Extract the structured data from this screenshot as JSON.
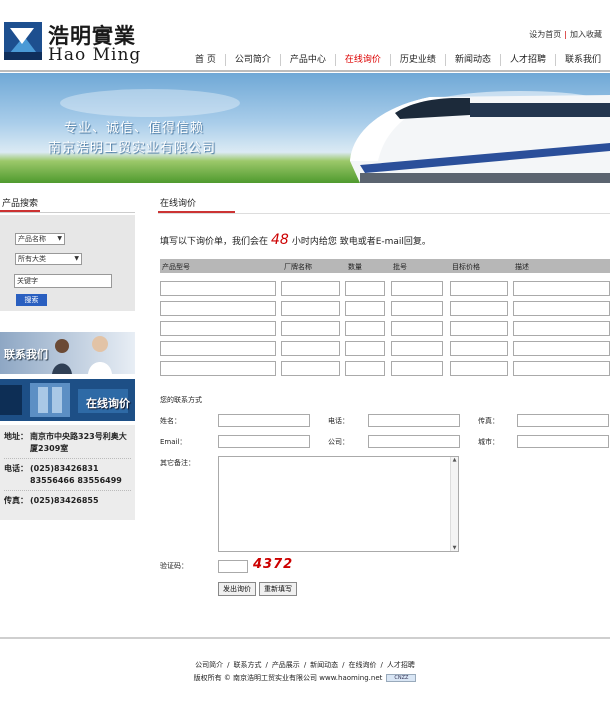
{
  "header": {
    "logo_cn": "浩明實業",
    "logo_en": "Hao Ming",
    "top_links": [
      "设为首页",
      "加入收藏"
    ],
    "nav": [
      "首 页",
      "公司简介",
      "产品中心",
      "在线询价",
      "历史业绩",
      "新闻动态",
      "人才招聘",
      "联系我们"
    ],
    "nav_active_index": 3
  },
  "banner": {
    "slogan1": "专业、诚信、值得信赖",
    "slogan2": "南京浩明工贸实业有限公司"
  },
  "sidebar": {
    "title": "产品搜索",
    "select_field": "产品名称",
    "select_category": "所有大类",
    "keyword_value": "关键字",
    "search_button": "搜索",
    "contact_image_text": "联系我们",
    "inquiry_image_text": "在线询价",
    "contact": {
      "address_label": "地址：",
      "address": "南京市中央路323号利奥大厦2309室",
      "phone_label": "电话：",
      "phone_lines": [
        "(025)83426831",
        "83556466 83556499"
      ],
      "fax_label": "传真：",
      "fax": "(025)83426855"
    }
  },
  "main": {
    "title": "在线询价",
    "intro_before": "填写以下询价单，我们会在",
    "intro_hours": "48",
    "intro_after": "小时内给您 致电或者E-mail回复。",
    "columns": [
      "产品型号",
      "厂牌名称",
      "数量",
      "批号",
      "目标价格",
      "描述"
    ],
    "row_count": 5,
    "contact_section": "您的联系方式",
    "fields": {
      "name": "姓名：",
      "phone": "电话：",
      "fax": "传真：",
      "email": "Email：",
      "company": "公司：",
      "city": "城市：",
      "remark": "其它备注：",
      "captcha_label": "验证码："
    },
    "captcha": "4372",
    "submit_button": "发出询价",
    "reset_button": "重新填写"
  },
  "footer": {
    "links": [
      "公司简介",
      "联系方式",
      "产品展示",
      "新闻动态",
      "在线询价",
      "人才招聘"
    ],
    "copyright": "版权所有 © 南京浩明工贸实业有限公司 www.haoming.net",
    "badge": "CNZZ"
  },
  "colors": {
    "accent_red": "#cc3333",
    "nav_active": "#dd0000",
    "table_head": "#b7b7b7",
    "search_button": "#2a5fc0"
  }
}
